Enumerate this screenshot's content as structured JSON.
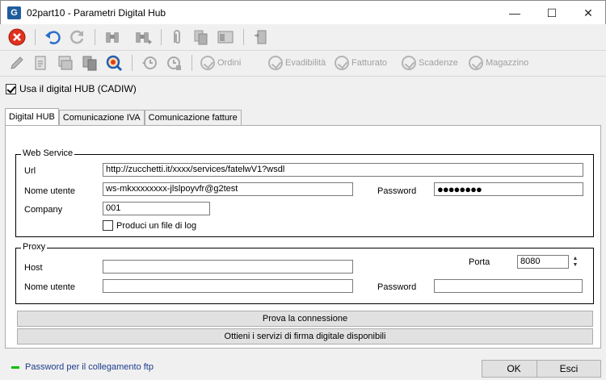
{
  "window": {
    "title": "02part10 - Parametri Digital Hub",
    "app_icon_glyph": "G",
    "minimize": "—",
    "maximize": "☐",
    "close": "✕"
  },
  "toolbar2": {
    "ordini": "Ordini",
    "evadibilita": "Evadibilità",
    "fatturato": "Fatturato",
    "scadenze": "Scadenze",
    "magazzino": "Magazzino"
  },
  "usa_hub": {
    "label": "Usa il digital HUB (CADIW)",
    "checked": true
  },
  "tabs": [
    {
      "label": "Digital HUB",
      "active": true
    },
    {
      "label": "Comunicazione IVA",
      "active": false
    },
    {
      "label": "Comunicazione fatture",
      "active": false
    }
  ],
  "web_service": {
    "legend": "Web Service",
    "url_label": "Url",
    "url_value": "http://zucchetti.it/xxxx/services/fatelwV1?wsdl",
    "user_label": "Nome utente",
    "user_value": "ws-mkxxxxxxxx-jlslpoyvfr@g2test",
    "password_label": "Password",
    "password_value": "●●●●●●●●",
    "company_label": "Company",
    "company_value": "001",
    "log_label": "Produci un file di log",
    "log_checked": false
  },
  "proxy": {
    "legend": "Proxy",
    "host_label": "Host",
    "host_value": "",
    "porta_label": "Porta",
    "porta_value": "8080",
    "user_label": "Nome utente",
    "user_value": "",
    "password_label": "Password",
    "password_value": ""
  },
  "buttons": {
    "test_connection": "Prova la connessione",
    "get_services": "Ottieni i servizi di firma digitale disponibili",
    "ok": "OK",
    "esci": "Esci"
  },
  "status": {
    "text": "Password per il collegamento ftp"
  },
  "colors": {
    "accent": "#1f5e9e",
    "status_led": "#00c000",
    "status_text": "#1c3c8c",
    "close_red": "#e0301e"
  }
}
